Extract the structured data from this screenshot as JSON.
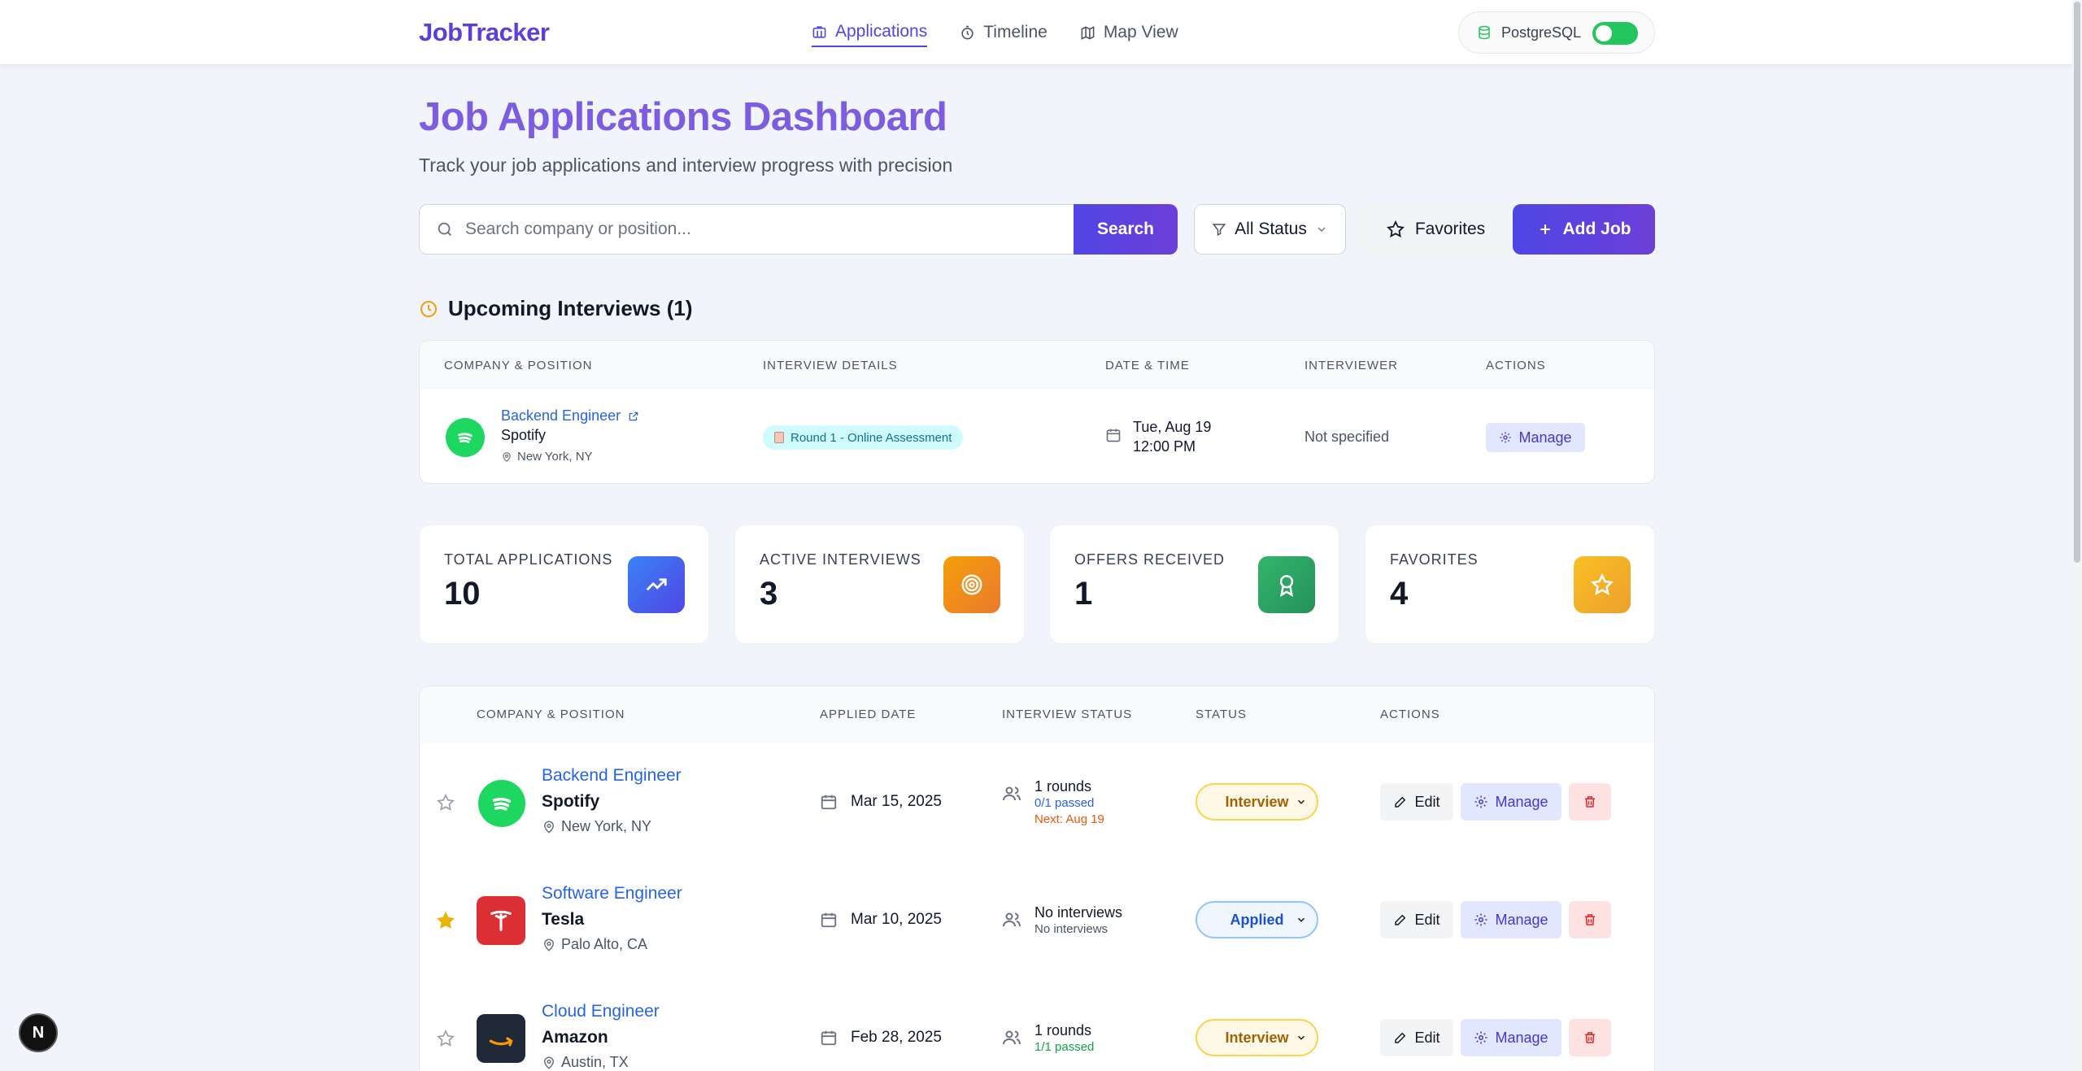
{
  "nav": {
    "brand": "JobTracker",
    "links": [
      {
        "label": "Applications",
        "icon": "briefcase-icon",
        "active": true
      },
      {
        "label": "Timeline",
        "icon": "timer-icon",
        "active": false
      },
      {
        "label": "Map View",
        "icon": "map-icon",
        "active": false
      }
    ],
    "db_label": "PostgreSQL",
    "db_toggle_on": true
  },
  "header": {
    "title": "Job Applications Dashboard",
    "subtitle": "Track your job applications and interview progress with precision"
  },
  "toolbar": {
    "search_placeholder": "Search company or position...",
    "search_value": "",
    "search_button": "Search",
    "status_filter": "All Status",
    "favorites_button": "Favorites",
    "add_button": "Add Job"
  },
  "upcoming": {
    "title": "Upcoming Interviews (1)",
    "columns": [
      "Company & Position",
      "Interview Details",
      "Date & Time",
      "Interviewer",
      "Actions"
    ],
    "rows": [
      {
        "position": "Backend Engineer",
        "company": "Spotify",
        "location": "New York, NY",
        "round": "Round 1 - Online Assessment",
        "date": "Tue, Aug 19",
        "time": "12:00 PM",
        "interviewer": "Not specified",
        "action": "Manage"
      }
    ]
  },
  "stats": [
    {
      "label": "Total Applications",
      "value": "10",
      "icon": "trending-up-icon",
      "color": "#3b5bdb"
    },
    {
      "label": "Active Interviews",
      "value": "3",
      "icon": "target-icon",
      "color": "#f08c2e"
    },
    {
      "label": "Offers Received",
      "value": "1",
      "icon": "award-icon",
      "color": "#2f9e5c"
    },
    {
      "label": "Favorites",
      "value": "4",
      "icon": "star-icon",
      "color": "#f2b233"
    }
  ],
  "applications": {
    "columns": [
      "Company & Position",
      "Applied Date",
      "Interview Status",
      "Status",
      "Actions"
    ],
    "actions": {
      "edit": "Edit",
      "manage": "Manage"
    },
    "rows": [
      {
        "favorite": false,
        "position": "Backend Engineer",
        "company": "Spotify",
        "location": "New York, NY",
        "applied": "Mar 15, 2025",
        "interview_main": "1 rounds",
        "interview_sub": "0/1 passed",
        "interview_next": "Next: Aug 19",
        "status": "Interview"
      },
      {
        "favorite": true,
        "position": "Software Engineer",
        "company": "Tesla",
        "location": "Palo Alto, CA",
        "applied": "Mar 10, 2025",
        "interview_main": "No interviews",
        "interview_sub": "No interviews",
        "interview_next": "",
        "status": "Applied"
      },
      {
        "favorite": false,
        "position": "Cloud Engineer",
        "company": "Amazon",
        "location": "Austin, TX",
        "applied": "Feb 28, 2025",
        "interview_main": "1 rounds",
        "interview_sub": "1/1 passed",
        "interview_next": "",
        "status": "Interview"
      }
    ]
  },
  "devtools_badge": "N"
}
